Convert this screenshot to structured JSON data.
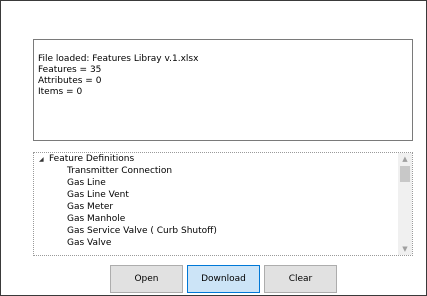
{
  "log": {
    "lines": [
      "File loaded: Features Libray v.1.xlsx",
      "Features = 35",
      "Attributes = 0",
      "Items = 0"
    ]
  },
  "tree": {
    "root_label": "Feature Definitions",
    "root_expanded": true,
    "items": [
      "Transmitter Connection",
      "Gas Line",
      "Gas Line Vent",
      "Gas Meter",
      "Gas Manhole",
      "Gas Service Valve ( Curb Shutoff)",
      "Gas Valve"
    ]
  },
  "buttons": {
    "open": "Open",
    "download": "Download",
    "clear": "Clear"
  },
  "icons": {
    "tree_expand": "chevron-down-icon",
    "scroll_up": "scroll-up-arrow-icon",
    "scroll_down": "scroll-down-arrow-icon"
  },
  "colors": {
    "download_highlight": "#cce4f7",
    "download_border": "#0078d7",
    "button_face": "#e1e1e1"
  }
}
